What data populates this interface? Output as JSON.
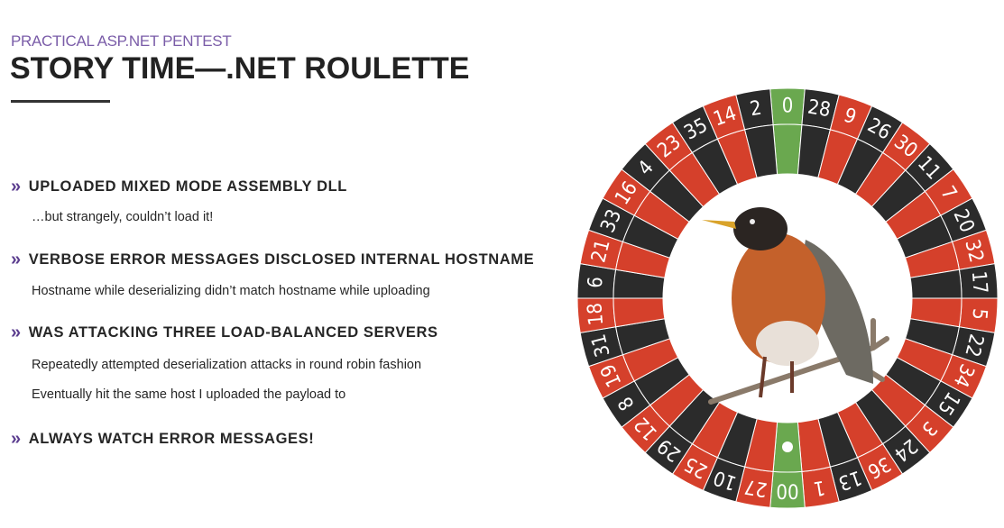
{
  "slide": {
    "subtitle": "PRACTICAL ASP.NET PENTEST",
    "title": "STORY TIME—.NET ROULETTE",
    "bullet_icon": "double-chevron-right",
    "bullets": [
      {
        "heading": "UPLOADED MIXED MODE ASSEMBLY DLL",
        "details": [
          "…but strangely, couldn’t load it!"
        ]
      },
      {
        "heading": "VERBOSE ERROR MESSAGES DISCLOSED INTERNAL HOSTNAME",
        "details": [
          "Hostname while deserializing didn’t match hostname while uploading"
        ]
      },
      {
        "heading": "WAS ATTACKING THREE LOAD-BALANCED SERVERS",
        "details": [
          "Repeatedly attempted deserialization attacks in round robin fashion",
          "Eventually hit the same host I uploaded the payload to"
        ]
      },
      {
        "heading": "ALWAYS WATCH ERROR MESSAGES!",
        "details": []
      }
    ]
  },
  "wheel": {
    "pockets": [
      "0",
      "28",
      "9",
      "26",
      "30",
      "11",
      "7",
      "20",
      "32",
      "17",
      "5",
      "22",
      "34",
      "15",
      "3",
      "24",
      "36",
      "13",
      "1",
      "00",
      "27",
      "10",
      "25",
      "29",
      "12",
      "8",
      "19",
      "31",
      "18",
      "6",
      "21",
      "33",
      "16",
      "4",
      "23",
      "35",
      "14",
      "2"
    ],
    "colors": {
      "red": "#d5402b",
      "black": "#2b2b2b",
      "green": "#6aa84f"
    },
    "red_pockets": [
      "9",
      "30",
      "7",
      "32",
      "5",
      "34",
      "3",
      "36",
      "1",
      "27",
      "25",
      "12",
      "19",
      "18",
      "21",
      "16",
      "23",
      "14"
    ],
    "ball_pocket": "00",
    "center_image": "robin-on-branch"
  },
  "colors": {
    "accent": "#7a5ca8",
    "text": "#262626"
  }
}
